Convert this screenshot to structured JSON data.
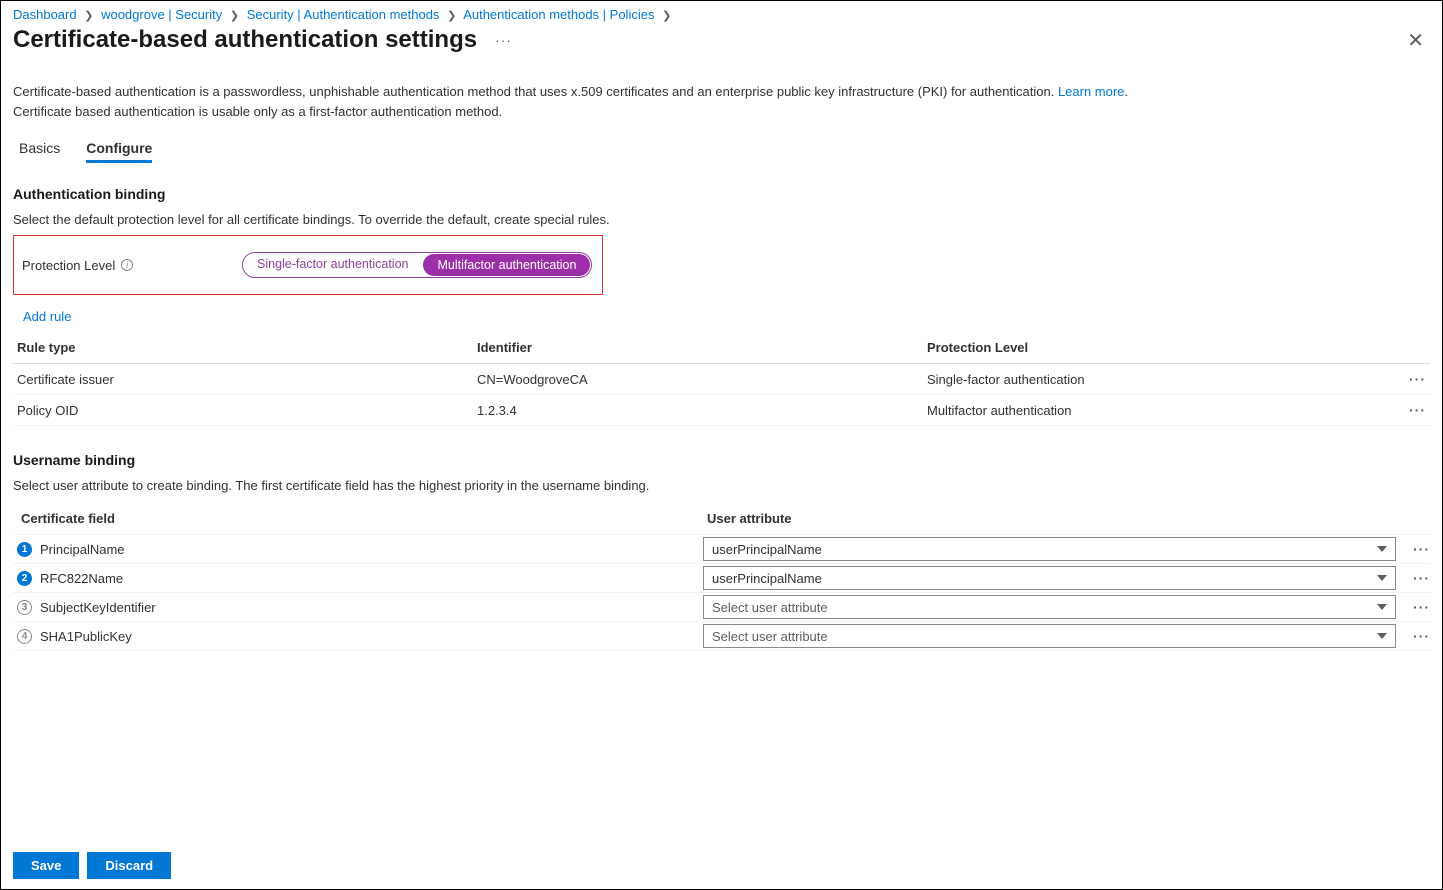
{
  "breadcrumb": {
    "items": [
      "Dashboard",
      "woodgrove | Security",
      "Security | Authentication methods",
      "Authentication methods | Policies"
    ]
  },
  "title": "Certificate-based authentication settings",
  "description_1": "Certificate-based authentication is a passwordless, unphishable authentication method that uses x.509 certificates and an enterprise public key infrastructure (PKI) for authentication.",
  "learn_more": "Learn more",
  "description_2": "Certificate based authentication is usable only as a first-factor authentication method.",
  "tabs": {
    "basics": "Basics",
    "configure": "Configure"
  },
  "auth_binding": {
    "heading": "Authentication binding",
    "sub": "Select the default protection level for all certificate bindings. To override the default, create special rules.",
    "label": "Protection Level",
    "single": "Single-factor authentication",
    "multi": "Multifactor authentication",
    "add_rule": "Add rule"
  },
  "rules": {
    "headers": {
      "type": "Rule type",
      "id": "Identifier",
      "prot": "Protection Level"
    },
    "rows": [
      {
        "type": "Certificate issuer",
        "id": "CN=WoodgroveCA",
        "prot": "Single-factor authentication"
      },
      {
        "type": "Policy OID",
        "id": "1.2.3.4",
        "prot": "Multifactor authentication"
      }
    ]
  },
  "username_binding": {
    "heading": "Username binding",
    "sub": "Select user attribute to create binding. The first certificate field has the highest priority in the username binding.",
    "cert_hdr": "Certificate field",
    "user_hdr": "User attribute",
    "placeholder": "Select user attribute",
    "rows": [
      {
        "num": "1",
        "filled": true,
        "cert": "PrincipalName",
        "user": "userPrincipalName"
      },
      {
        "num": "2",
        "filled": true,
        "cert": "RFC822Name",
        "user": "userPrincipalName"
      },
      {
        "num": "3",
        "filled": false,
        "cert": "SubjectKeyIdentifier",
        "user": ""
      },
      {
        "num": "4",
        "filled": false,
        "cert": "SHA1PublicKey",
        "user": ""
      }
    ]
  },
  "footer": {
    "save": "Save",
    "discard": "Discard"
  }
}
